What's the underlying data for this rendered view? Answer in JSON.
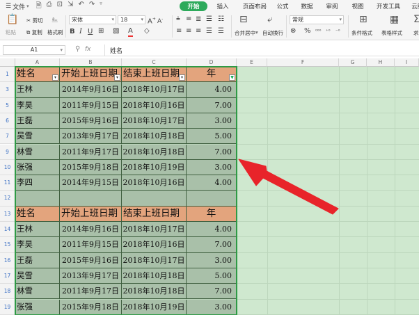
{
  "menu": {
    "file": "文件",
    "tabs": [
      "开始",
      "插入",
      "页面布局",
      "公式",
      "数据",
      "审阅",
      "视图",
      "开发工具",
      "云服务"
    ],
    "active_tab": "开始"
  },
  "ribbon": {
    "paste": "粘贴",
    "cut": "剪切",
    "copy": "复制",
    "format_painter": "格式刷",
    "font_name": "宋体",
    "font_size": "18",
    "merge_center": "合并居中",
    "wrap_text": "自动换行",
    "number_format": "常规",
    "conditional_format": "条件格式",
    "table_style": "表格样式",
    "trailing": "求"
  },
  "formula_bar": {
    "cell_ref": "A1",
    "fx": "fx",
    "value": "姓名"
  },
  "columns": [
    "A",
    "B",
    "C",
    "D",
    "E",
    "F",
    "G",
    "H",
    "I"
  ],
  "rows": [
    "1",
    "3",
    "5",
    "6",
    "7",
    "9",
    "10",
    "11",
    "12",
    "13",
    "14",
    "15",
    "16",
    "17",
    "18",
    "19"
  ],
  "table1": {
    "headers": [
      "姓名",
      "开始上班日期",
      "结束上班日期",
      "年"
    ],
    "data": [
      [
        "王林",
        "2014年9月16日",
        "2018年10月17日",
        "4.00"
      ],
      [
        "李昊",
        "2011年9月15日",
        "2018年10月16日",
        "7.00"
      ],
      [
        "王磊",
        "2015年9月16日",
        "2018年10月17日",
        "3.00"
      ],
      [
        "吴雪",
        "2013年9月17日",
        "2018年10月18日",
        "5.00"
      ],
      [
        "林雪",
        "2011年9月17日",
        "2018年10月18日",
        "7.00"
      ],
      [
        "张强",
        "2015年9月18日",
        "2018年10月19日",
        "3.00"
      ],
      [
        "李四",
        "2014年9月15日",
        "2018年10月16日",
        "4.00"
      ]
    ]
  },
  "table2": {
    "headers": [
      "姓名",
      "开始上班日期",
      "结束上班日期",
      "年"
    ],
    "data": [
      [
        "王林",
        "2014年9月16日",
        "2018年10月17日",
        "4.00"
      ],
      [
        "李昊",
        "2011年9月15日",
        "2018年10月16日",
        "7.00"
      ],
      [
        "王磊",
        "2015年9月16日",
        "2018年10月17日",
        "3.00"
      ],
      [
        "吴雪",
        "2013年9月17日",
        "2018年10月18日",
        "5.00"
      ],
      [
        "林雪",
        "2011年9月17日",
        "2018年10月18日",
        "7.00"
      ],
      [
        "张强",
        "2015年9月18日",
        "2018年10月19日",
        "3.00"
      ]
    ]
  },
  "colors": {
    "header_fill": "#e3a47d",
    "body_fill": "#a9c0a9",
    "sheet_bg": "#cfe8cf",
    "accent": "#2daa5b",
    "arrow": "#e8242a"
  }
}
